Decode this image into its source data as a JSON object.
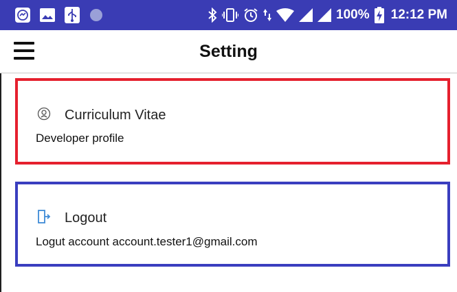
{
  "status_bar": {
    "icons_left": [
      "messenger-icon",
      "image-icon",
      "usb-icon",
      "record-dot-icon"
    ],
    "icons_right": [
      "bluetooth-icon",
      "vibrate-icon",
      "alarm-icon",
      "data-arrows-icon",
      "wifi-icon",
      "signal-icon",
      "signal-icon",
      "battery-charging-icon"
    ],
    "battery": "100%",
    "time": "12:12 PM"
  },
  "app_bar": {
    "title": "Setting",
    "menu_icon": "hamburger-menu-icon"
  },
  "items": [
    {
      "title": "Curriculum Vitae",
      "subtitle": "Developer profile",
      "icon": "profile-icon",
      "highlight_color": "#e5202e"
    },
    {
      "title": "Logout",
      "subtitle": "Logut account account.tester1@gmail.com",
      "icon": "logout-icon",
      "highlight_color": "#3a3ebf"
    }
  ],
  "colors": {
    "status_bar": "#3a3cb4",
    "background": "#ffffff",
    "logout_icon": "#3e8ad6"
  }
}
